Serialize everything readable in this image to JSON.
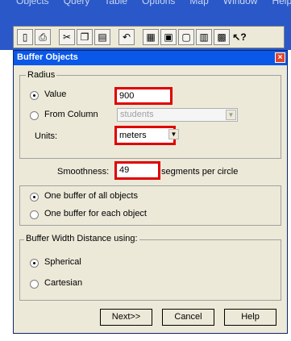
{
  "app": {
    "menu": [
      "Objects",
      "Query",
      "Table",
      "Options",
      "Map",
      "Window",
      "Help"
    ]
  },
  "toolbar": {
    "icons": [
      "window-icon",
      "print-icon",
      "cut-icon",
      "copy-icon",
      "paste-icon",
      "undo-icon",
      "browser-icon",
      "map-window-icon",
      "layout-icon",
      "graph-icon",
      "redistrict-icon",
      "help-pointer-icon"
    ]
  },
  "dialog": {
    "title": "Buffer Objects",
    "close_glyph": "×",
    "radius": {
      "legend": "Radius",
      "value_label": "Value",
      "value": "900",
      "from_column_label": "From Column",
      "from_column_value": "students",
      "units_label": "Units:",
      "units_value": "meters"
    },
    "smoothness": {
      "label": "Smoothness:",
      "value": "49",
      "suffix": "segments per circle"
    },
    "buffer_mode": {
      "one_all": "One buffer of all objects",
      "one_each": "One buffer for each object"
    },
    "width_distance": {
      "legend": "Buffer Width Distance using:",
      "spherical": "Spherical",
      "cartesian": "Cartesian"
    },
    "buttons": {
      "next": "Next>>",
      "cancel": "Cancel",
      "help": "Help"
    }
  }
}
